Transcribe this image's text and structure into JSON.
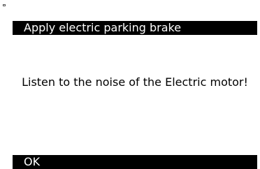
{
  "header": {
    "title": "Apply electric parking brake"
  },
  "main": {
    "message": "Listen to the noise of the Electric motor!"
  },
  "footer": {
    "ok_label": "OK"
  },
  "colors": {
    "bar_background": "#000000",
    "bar_text": "#ffffff",
    "page_background": "#ffffff",
    "body_text": "#000000"
  }
}
